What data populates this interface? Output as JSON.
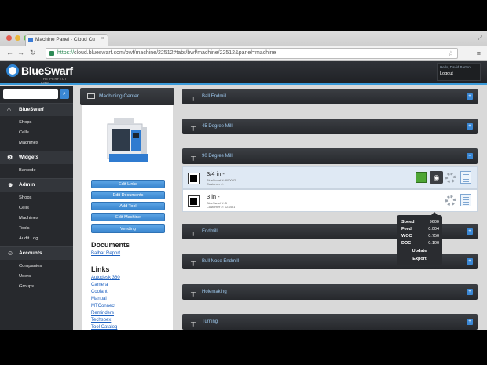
{
  "browser": {
    "tab_title": "Machine Panel - Cloud Cu",
    "url_scheme": "https://",
    "url_rest": "cloud.blueswarf.com/bwf/machine/22512#tabr/bwf/machine/22512&panel=machine",
    "back_icon": "arrow-left-icon",
    "forward_icon": "arrow-right-icon",
    "reload_icon": "reload-icon",
    "star_icon": "star-icon",
    "menu_icon": "hamburger-icon",
    "traffic_colors": [
      "#e25b4f",
      "#e9b73b",
      "#5fc14b"
    ]
  },
  "header": {
    "brand": "BlueSwarf",
    "tagline": "THE PERFECT CHIP",
    "user_greeting": "Hello, David Barton",
    "logout": "Logout",
    "accent": "#3a9ad9"
  },
  "sidebar": {
    "search_placeholder": "",
    "sections": [
      {
        "title": "BlueSwarf",
        "icon": "home-icon",
        "items": [
          "Shops",
          "Cells",
          "Machines"
        ]
      },
      {
        "title": "Widgets",
        "icon": "gear-icon",
        "items": [
          "Barcode"
        ]
      },
      {
        "title": "Admin",
        "icon": "user-icon",
        "items": [
          "Shops",
          "Cells",
          "Machines",
          "Tools",
          "Audit Log"
        ]
      },
      {
        "title": "Accounts",
        "icon": "users-icon",
        "items": [
          "Companies",
          "Users",
          "Groups"
        ]
      }
    ]
  },
  "machine": {
    "panel_title": "Machining Center",
    "buttons": [
      "Edit Links",
      "Edit Documents",
      "Add Tool",
      "Edit Machine",
      "Vending"
    ],
    "documents_heading": "Documents",
    "documents": [
      "Balbar Report"
    ],
    "links_heading": "Links",
    "links": [
      "Autodesk 360",
      "Camera",
      "Coolant",
      "Manual",
      "MTConnect",
      "Reminders",
      "Techspex",
      "Tool Catalog"
    ]
  },
  "tool_groups": [
    {
      "title": "Ball Endmill",
      "expanded": false
    },
    {
      "title": "45 Degree Mill",
      "expanded": false
    },
    {
      "title": "90 Degree Mill",
      "expanded": true
    },
    {
      "title": "Endmill",
      "expanded": false
    },
    {
      "title": "Bull Nose Endmill",
      "expanded": false
    },
    {
      "title": "Holemaking",
      "expanded": false
    },
    {
      "title": "Turning",
      "expanded": false
    }
  ],
  "tools": [
    {
      "name": "3/4 in -",
      "line1": "BlueSwarf #: 800002",
      "line2": "Customer #:"
    },
    {
      "name": "3 in -",
      "line1": "BlueSwarf #: 5",
      "line2": "Customer #: 123451"
    }
  ],
  "popup": {
    "rows": [
      {
        "label": "Speed",
        "value": "9600"
      },
      {
        "label": "Feed",
        "value": "0.004"
      },
      {
        "label": "WOC",
        "value": "0.750"
      },
      {
        "label": "DOC",
        "value": "0.100"
      }
    ],
    "update": "Update",
    "export": "Export"
  }
}
